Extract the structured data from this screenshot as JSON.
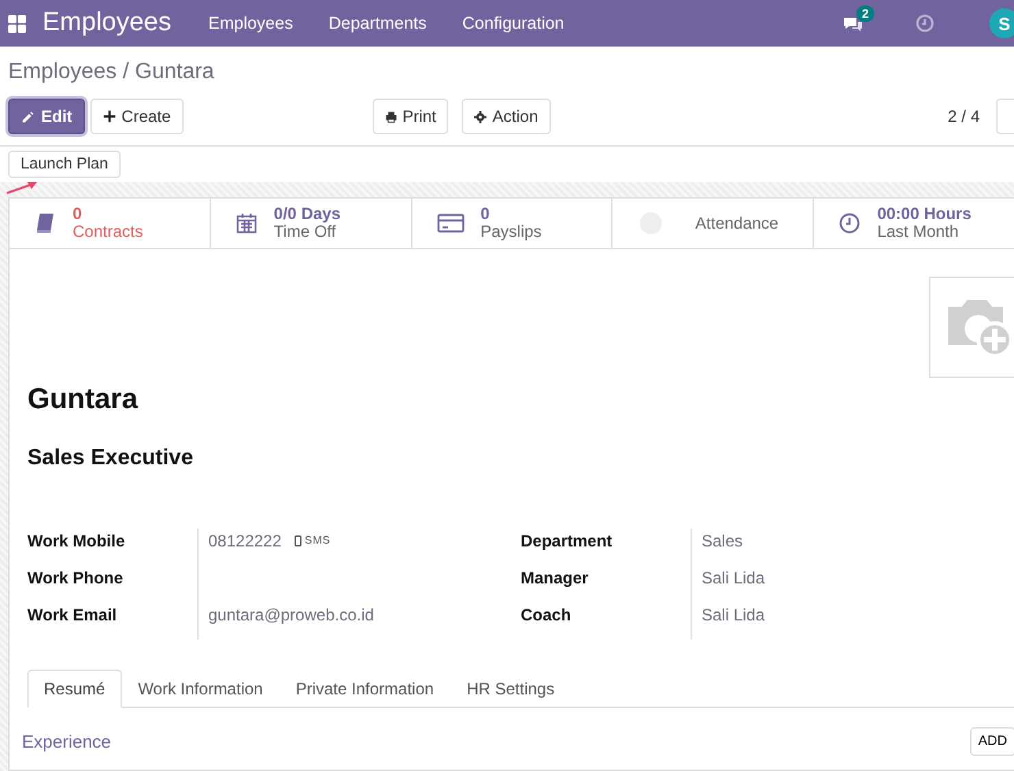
{
  "navbar": {
    "app_title": "Employees",
    "menu": [
      "Employees",
      "Departments",
      "Configuration"
    ],
    "message_count": "2",
    "avatar_letter": "S"
  },
  "breadcrumb": {
    "parent": "Employees",
    "separator": "/",
    "current": "Guntara"
  },
  "toolbar": {
    "left": [
      {
        "label": "Edit",
        "kind": "primary"
      },
      {
        "label": "Create",
        "kind": "secondary"
      }
    ],
    "middle": [
      {
        "label": "Print"
      },
      {
        "label": "Action"
      }
    ],
    "pager": "2 / 4"
  },
  "header_buttons": [
    "Launch Plan"
  ],
  "stats": [
    {
      "kind": "counter",
      "value": "0",
      "label": "Contracts",
      "alert": true
    },
    {
      "kind": "counter",
      "value": "0/0 Days",
      "label": "Time Off",
      "alert": false
    },
    {
      "kind": "counter",
      "value": "0",
      "label": "Payslips",
      "alert": false
    },
    {
      "kind": "presence",
      "label": "Attendance"
    },
    {
      "kind": "counter",
      "value": "00:00 Hours",
      "label": "Last Month",
      "alert": false
    }
  ],
  "employee": {
    "name": "Guntara",
    "job_title": "Sales Executive"
  },
  "fields_left": [
    {
      "label": "Work Mobile",
      "value": "08122222",
      "sms": "SMS"
    },
    {
      "label": "Work Phone"
    },
    {
      "label": "Work Email",
      "value": "guntara@proweb.co.id"
    }
  ],
  "fields_right": [
    {
      "label": "Department",
      "value": "Sales"
    },
    {
      "label": "Manager",
      "value": "Sali Lida"
    },
    {
      "label": "Coach",
      "value": "Sali Lida"
    }
  ],
  "tabs": [
    {
      "label": "Resumé",
      "selected": true
    },
    {
      "label": "Work Information",
      "selected": false
    },
    {
      "label": "Private Information",
      "selected": false
    },
    {
      "label": "HR Settings",
      "selected": false
    }
  ],
  "resume": {
    "section": "Experience",
    "add_button": "ADD"
  }
}
